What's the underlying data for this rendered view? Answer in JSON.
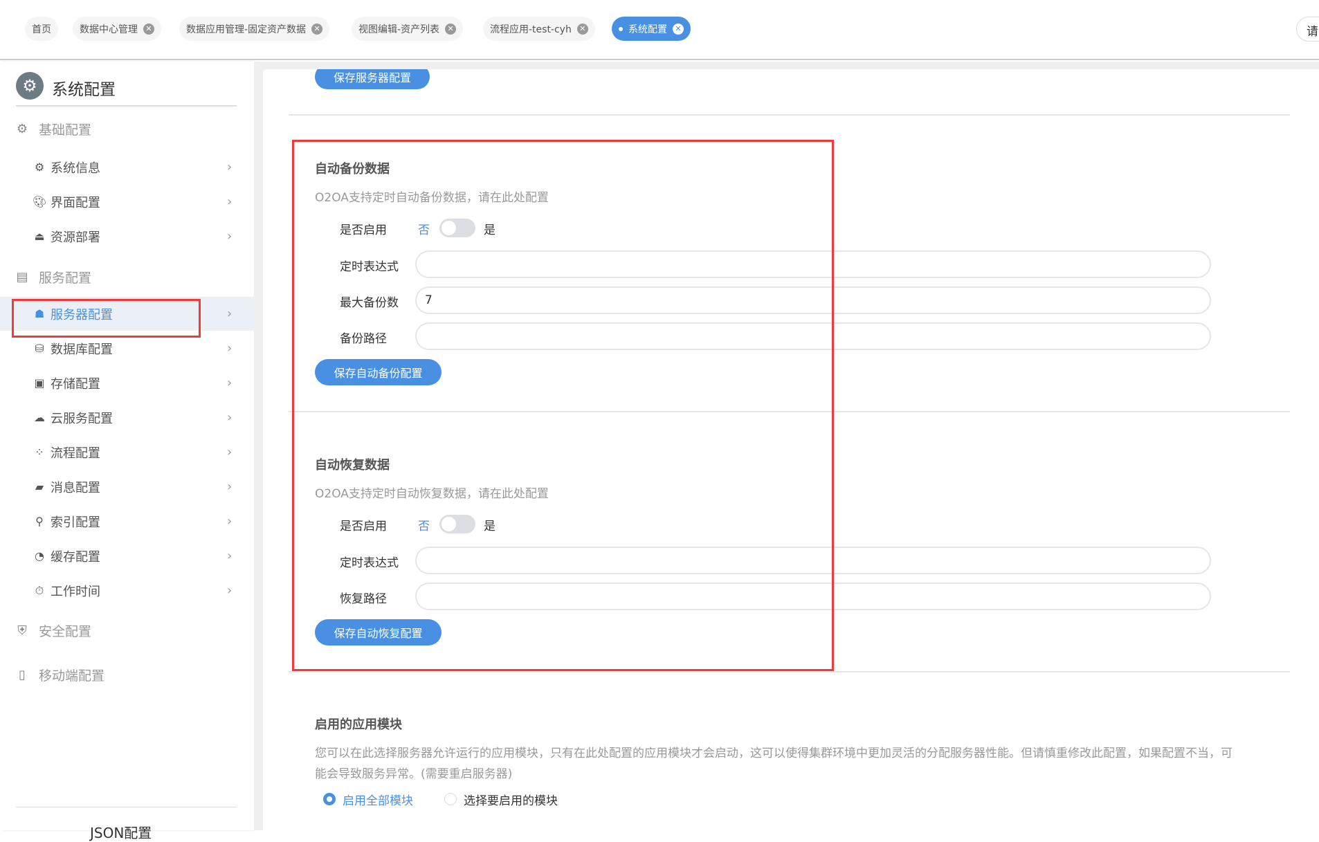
{
  "tabs": [
    {
      "label": "首页",
      "closable": false,
      "active": false
    },
    {
      "label": "数据中心管理",
      "closable": true,
      "active": false
    },
    {
      "label": "数据应用管理-固定资产数据",
      "closable": true,
      "active": false
    },
    {
      "label": "视图编辑-资产列表",
      "closable": true,
      "active": false
    },
    {
      "label": "流程应用-test-cyh",
      "closable": true,
      "active": false
    },
    {
      "label": "系统配置",
      "closable": true,
      "active": true
    }
  ],
  "search_partial": "请",
  "sidebar": {
    "title": "系统配置",
    "groups": [
      {
        "label": "基础配置",
        "icon": "gear-icon"
      },
      {
        "label": "服务配置",
        "icon": "server-icon"
      },
      {
        "label": "安全配置",
        "icon": "shield-icon"
      },
      {
        "label": "移动端配置",
        "icon": "mobile-icon"
      }
    ],
    "items": [
      {
        "label": "系统信息",
        "icon": "gear-icon"
      },
      {
        "label": "界面配置",
        "icon": "palette-icon"
      },
      {
        "label": "资源部署",
        "icon": "upload-icon"
      },
      {
        "label": "服务器配置",
        "icon": "server-user-icon",
        "selected": true
      },
      {
        "label": "数据库配置",
        "icon": "database-icon"
      },
      {
        "label": "存储配置",
        "icon": "archive-icon"
      },
      {
        "label": "云服务配置",
        "icon": "cloud-icon"
      },
      {
        "label": "流程配置",
        "icon": "flow-icon"
      },
      {
        "label": "消息配置",
        "icon": "message-icon"
      },
      {
        "label": "索引配置",
        "icon": "search-icon"
      },
      {
        "label": "缓存配置",
        "icon": "pie-icon"
      },
      {
        "label": "工作时间",
        "icon": "stopwatch-icon"
      }
    ],
    "footer": "JSON配置"
  },
  "main": {
    "save_server_btn": "保存服务器配置",
    "backup": {
      "title": "自动备份数据",
      "desc": "O2OA支持定时自动备份数据，请在此处配置",
      "enable_label": "是否启用",
      "off": "否",
      "on": "是",
      "enabled": false,
      "cron_label": "定时表达式",
      "cron_value": "",
      "max_label": "最大备份数",
      "max_value": "7",
      "path_label": "备份路径",
      "path_value": "",
      "save_btn": "保存自动备份配置"
    },
    "restore": {
      "title": "自动恢复数据",
      "desc": "O2OA支持定时自动恢复数据，请在此处配置",
      "enable_label": "是否启用",
      "off": "否",
      "on": "是",
      "enabled": false,
      "cron_label": "定时表达式",
      "cron_value": "",
      "path_label": "恢复路径",
      "path_value": "",
      "save_btn": "保存自动恢复配置"
    },
    "modules": {
      "title": "启用的应用模块",
      "desc1": "您可以在此选择服务器允许运行的应用模块，只有在此处配置的应用模块才会启动，这可以使得集群环境中更加灵活的分配服务器性能。但请慎重修改此配置，如果配置不当，可",
      "desc2": "能会导致服务异常。(需要重启服务器)",
      "opt_all": "启用全部模块",
      "opt_select": "选择要启用的模块",
      "selected": "opt_all"
    }
  },
  "colors": {
    "accent": "#4a90e2",
    "highlight": "#f03a3a"
  }
}
